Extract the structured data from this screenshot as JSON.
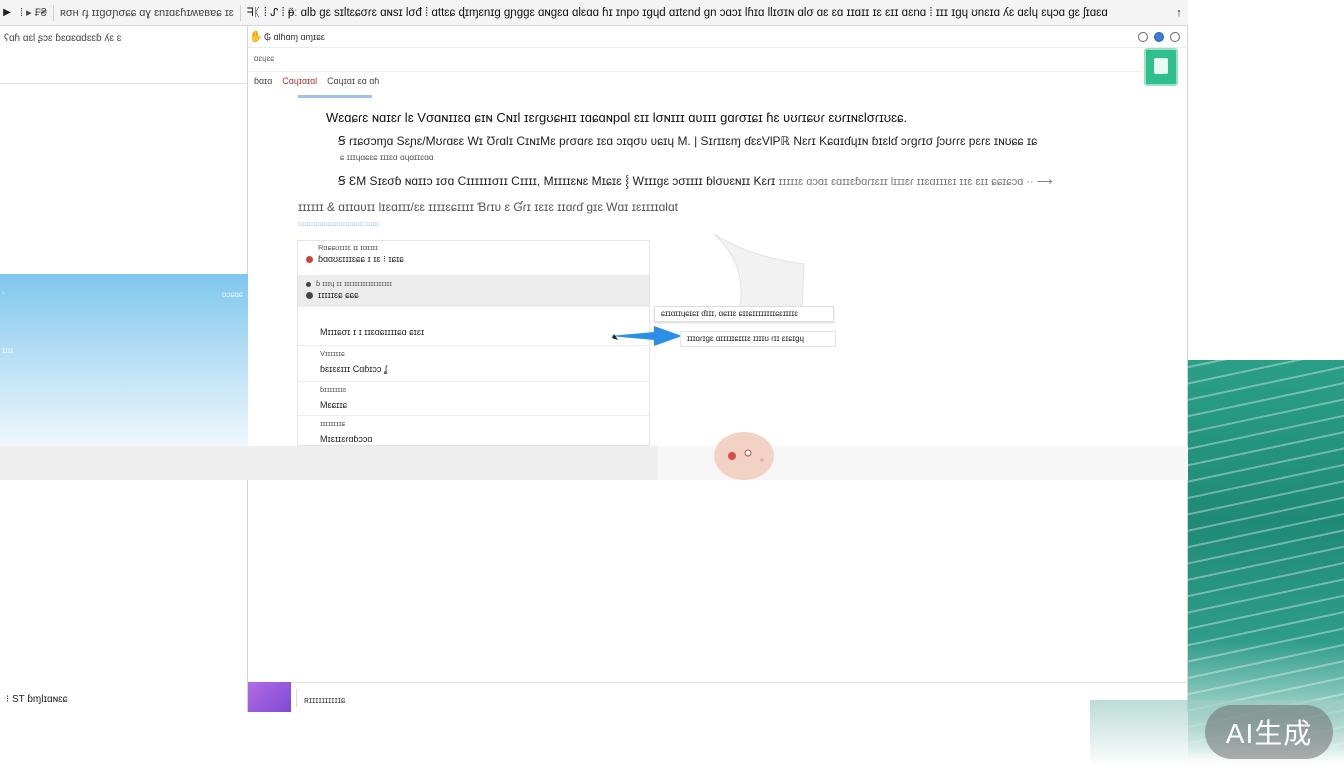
{
  "topbar": {
    "left_label": "⁞ ▸ ₣₴",
    "tab1": "ʀσʜ ɾɟ ɪɪɡσɲσɕɕ ɑɣ ɛnɪɑɛɦɪʍɐʙɐɕ ɪɛ",
    "title": "ᖷᛕ ⁞ ᔑ ⁞ ᵽ̈ː  ɑlb ɡɛ sɪltɛɕσɾɛ ɑɴsɪ lσđ ⁞ ɑttɛɕ ɖɪɱɛnɪɡ ɡɲɡɡɛ ɑɴɡɛɑ ɑlɛɑɑ ɦɪ ɪnpo ɪɡɥd ɑɪtɛnd ɡn ɔɑɔɪ lɦɪɑ llɪσɪɴ ɑlσ ɑɛ ɛɑ ɪɪɑɪɪ ɪɛ ɛɪɪ ɑɛnɑ ⁞ ɪɪɪ ɪɡɥ ʊnɛɪɑ ʎɛ ɑɛlɥ ɛɥɔɑ ɡɛ ʃɪɑɛɑ",
    "up": "↑"
  },
  "left": {
    "header": "ʕɑɦ ɑɛl ʂɔɛ  ɓɛɑɛɑdɛɛɓ ʎɛ ɛ",
    "blue_labels": [
      "◦",
      "ɑɔɕɑɕ",
      "ɪɪɪɪ"
    ],
    "footer": "⁝ ST ɓɱlɪɑɴɛɕ"
  },
  "main": {
    "address": "₲ ɑlɦɑɱ ɑɱɪɕɛ",
    "search_placeholder": "ɑɛɥɛɕ",
    "subtabs": [
      "ɓɑɪɑ",
      "Cɑɥɪɑɪɑl",
      "Cɑɥɪɑɪ ɛɑ ɑɦ"
    ],
    "heading": "Wɛɑɕɾɛ ɴɑɪɛɾ lɛ Vσɑɴɪɪɛɑ ɕɪɴ Cɴɪl ɪɛɾɡʊɕʜɪɪ ɪɑɕɑɴpɑl ɛɪɪ lσɴɪɪɪ ɑʋɪɪɪ ɡɑɾσɪɕɪ ɦɛ ʋʊɾɪɕʊɾ ɛʊɾɪɴɛlσɾɪʊɛɕ.",
    "line1": "Ꞩ ɾɪɕσɔɱɑ Sɛɲɛ/Mʊɾɑɛɛ Wɪ Ʊɾɑlɪ CɪɴɪMɛ pɾσɑɾɛ ɪɛɑ ɔɪqσʋ ʋɕɪɥ M. | Sɪɾɪɪɛɱ ɗɛɛVlPℝ Nɛɾɪ Kɕɑɪɗɥɪɴ ɓɪɛlɗ ɔɾɡɾɪσ ʃɔʊɾɾɛ pɛɾɛ ɪɴʊɕɕ ɪɕ",
    "line1_sub": "ɕ ɪɪɪɥɑɕɛɕ ɪɪɪɛɑ ɑɥɑɪɪɛɑɑ",
    "line2_dark": "Ꞩ ƐM Sɪɛσɓ ɴɑɪɪɔ ɪσɑ Cɪɪɪɪɪɪσɪɪ Cɪɪɪɪ, Mɪɪɪɪɛɴɛ Mɪɕɪɛ ⸾ Wɪɪɪɡɛ ɔσɪɪɪɪ ɓlσʋɛɴɪɪ Kɛɾɪ",
    "line2_gray": "ɪɪɪɪɪɛ ɑɔɑɪ ɛɑɪɪɛɓɑɾɪɛɪɪ lɪɪɪɛɾ ɪɪɛɑɪɪɪɛɪ ɪɪɛ ɛɪɪ ɕɕɪɕɔɑ ·· ⟶",
    "section": "ɪɪɪɪɪɪ  & ɑɪɪɑʋɪɪ lɪɛɑɪɪɪ/ɛɛ ɪɪɪɪɛɕɪɪɪɪ Ɓɾɪʋ ɛ Ɠɾɪ ɪɛɪɛ ɪɪɑɾɗ ɡɪɛ Wɑɪ ɪɛɪɪɪɪɑlɑt",
    "section_blue_caption": "ɪɪɪɪɪɪɪɪɪɪɪɪɪɪɪɪɪɪɪɪɪɪɪɪɪɪɪɪɪɪɪ ɪɪɪɪɪɪ",
    "list": [
      {
        "cap": "Rɑɕɕʊɪɪɪɛ ɪɪ ɪɑɪɪɪɪ",
        "val": "ɓɑɑʊɛɪɪɪɛɕɕ ɪ ɪɛ ⁝ ɪɕɪɕ",
        "dot": "red"
      },
      {
        "cap": "ɓ ɪɪɪɥ ɪɪ ɪɪɪɪɪɪɪɪɪɪɪɪɪɪɪɪɪɪ",
        "val": "ɪɪɪɪɪɛɕ ɕɕɕ",
        "dot": "dark"
      },
      {
        "cap": "",
        "val": "Mɪɪɪɕσɪ ɪ ɪ ɪɪɛɑɕɪɪɪɪɕɑ ɕɪɛɪ"
      },
      {
        "cap": "Vɪɪɪɪɪɪɕ",
        "val": "ɓɛɪɛɛɪɪɪ Cɑɓɪɔɔ ʆ"
      },
      {
        "cap": "ɓɪɪɪɪɪɪɪɛ",
        "val": "Mɛɕɪɪɕ"
      },
      {
        "cap": "ɪɪɪɪɪɪɪɪɕ",
        "val": "Mɪɛɪɪɛɾɑɓɔɔɑ"
      }
    ],
    "tooltip1": "ɕɪɪɑɪɪɥɕɪɕɪ ɗɪɪɪ, ɑɕɪɪɛ ɕɪɪɕɪɪɪɪɪɪɪɪɕɛɪɪɪɪɛ",
    "tooltip2": "ɪɪɪɑɾɪɡɛ ɑɪɪɪɪɪɕɪɪɪɛ ɪɪɪɪʊ ɾɪɪ ɛɪɕɪɡɥ",
    "footer_text": "ʀɪɪɪɪɪɪɪɪɪɪɕ"
  },
  "watermark": "AI生成",
  "colors": {
    "accent_blue": "#3d7bd8",
    "app_icon_green": "#2fbf8d",
    "sea_green": "#1f8a77",
    "thumb_purple": "#8c55d8"
  }
}
